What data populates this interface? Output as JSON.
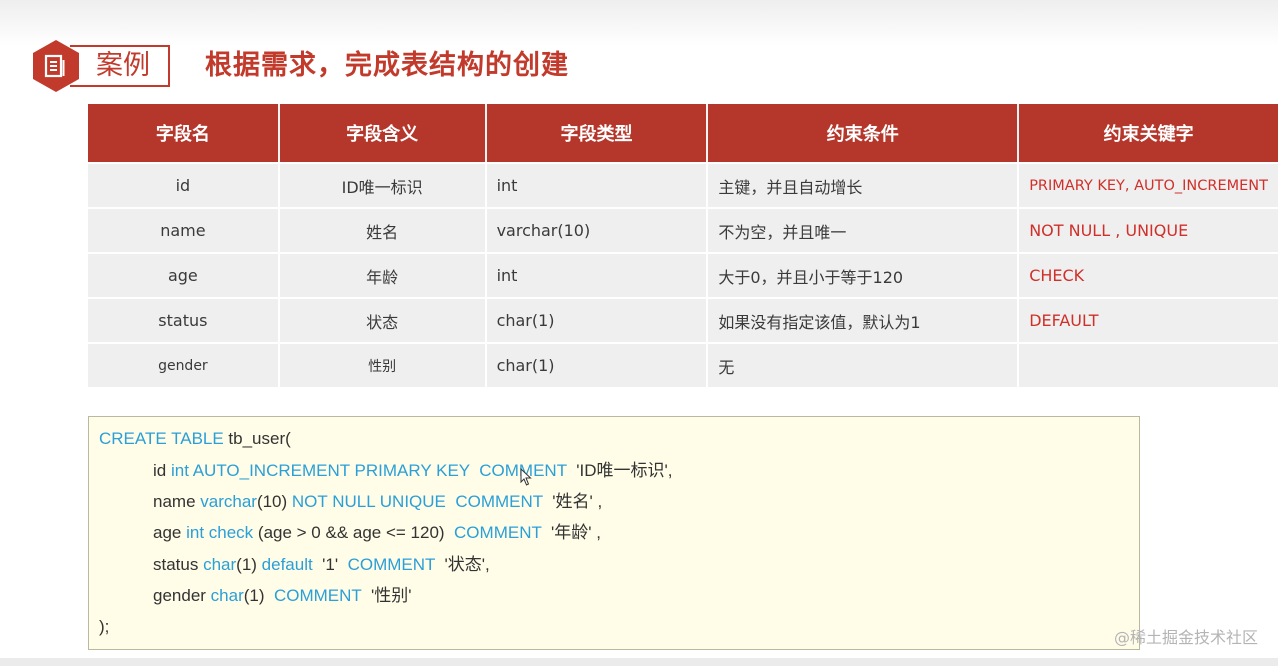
{
  "header": {
    "badge_label": "案例",
    "title": "根据需求，完成表结构的创建"
  },
  "table": {
    "columns": [
      "字段名",
      "字段含义",
      "字段类型",
      "约束条件",
      "约束关键字"
    ],
    "rows": [
      [
        "id",
        "ID唯一标识",
        "int",
        "主键，并且自动增长",
        "PRIMARY KEY, AUTO_INCREMENT"
      ],
      [
        "name",
        "姓名",
        "varchar(10)",
        "不为空，并且唯一",
        "NOT  NULL , UNIQUE"
      ],
      [
        "age",
        "年龄",
        "int",
        "大于0，并且小于等于120",
        "CHECK"
      ],
      [
        "status",
        "状态",
        "char(1)",
        "如果没有指定该值，默认为1",
        "DEFAULT"
      ],
      [
        "gender",
        "性别",
        "char(1)",
        "无",
        ""
      ]
    ]
  },
  "code": {
    "l1_kw": "CREATE TABLE",
    "l1_rest": " tb_user(",
    "l2_a": "id ",
    "l2_b": "int AUTO_INCREMENT PRIMARY KEY  COMMENT",
    "l2_c": "  'ID唯一标识',",
    "l3_a": "name ",
    "l3_b": "varchar",
    "l3_c": "(10) ",
    "l3_d": "NOT NULL UNIQUE  COMMENT",
    "l3_e": "  '姓名' ,",
    "l4_a": "age ",
    "l4_b": "int check",
    "l4_c": " (age > 0 && age <= 120)  ",
    "l4_d": "COMMENT",
    "l4_e": "  '年龄' ,",
    "l5_a": "status ",
    "l5_b": "char",
    "l5_c": "(1) ",
    "l5_d": "default",
    "l5_e": "  '1'  ",
    "l5_f": "COMMENT",
    "l5_g": "  '状态',",
    "l6_a": "gender ",
    "l6_b": "char",
    "l6_c": "(1)  ",
    "l6_d": "COMMENT",
    "l6_e": "  '性别'",
    "l7": ");"
  },
  "watermark": "@稀土掘金技术社区",
  "colors": {
    "accent": "#c23a2b",
    "table_header": "#b5372b",
    "keyword_blue": "#2a9fd8",
    "constraint_red": "#d0302a",
    "code_bg": "#fffde8"
  },
  "icons": {
    "badge": "document-icon",
    "cursor": "mouse-pointer-icon"
  }
}
